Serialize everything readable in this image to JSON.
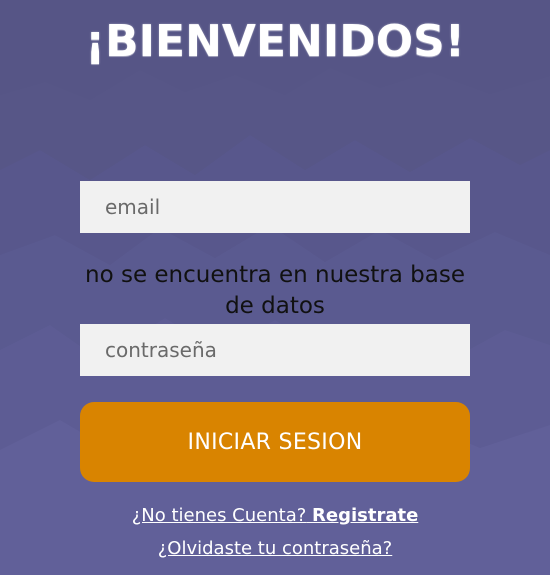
{
  "title": "¡BIENVENIDOS!",
  "fields": {
    "email_placeholder": "email",
    "password_placeholder": "contraseña"
  },
  "error_message": "no se encuentra en nuestra base de datos",
  "submit_label": "INICIAR SESION",
  "links": {
    "signup_prefix": "¿No tienes Cuenta?",
    "signup_link": "Registrate",
    "forgot": "¿Olvidaste tu contraseña?"
  },
  "colors": {
    "background": "#565586",
    "button": "#d98400",
    "field": "#f1f1f1"
  }
}
